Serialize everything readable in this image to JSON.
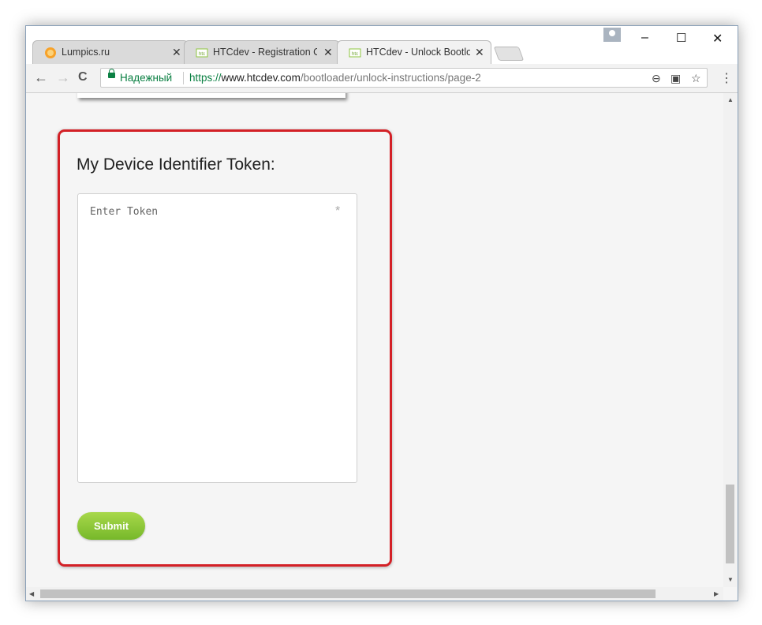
{
  "browser": {
    "tabs": [
      {
        "label": "Lumpics.ru",
        "active": false
      },
      {
        "label": "HTCdev - Registration Co",
        "active": false
      },
      {
        "label": "HTCdev - Unlock Bootloa",
        "active": true
      }
    ],
    "window_controls": {
      "minimize": "–",
      "maximize": "☐",
      "close": "✕"
    },
    "nav": {
      "back": "←",
      "forward": "→",
      "reload": "C"
    },
    "security_label": "Надежный",
    "url": {
      "scheme": "https://",
      "host": "www.htcdev.com",
      "path": "/bootloader/unlock-instructions/page-2"
    },
    "menu_glyph": "⋮"
  },
  "form": {
    "title": "My Device Identifier Token:",
    "token_placeholder": "Enter Token",
    "required_mark": "*",
    "submit_label": "Submit"
  },
  "colors": {
    "highlight_border": "#d32026",
    "submit_gradient": [
      "#a8d84a",
      "#76b82a"
    ],
    "secure_green": "#0b8043"
  }
}
